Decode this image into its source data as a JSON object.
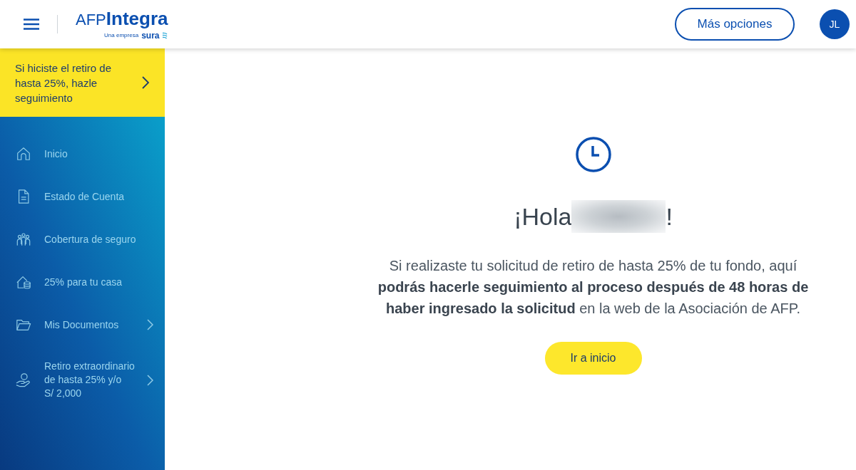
{
  "header": {
    "logo": {
      "wordmark": "AFP**Integra**",
      "tagline": "Una empresa",
      "brand": "sura"
    },
    "more_button": "Más opciones",
    "avatar_initials": "JL"
  },
  "sidebar": {
    "banner": {
      "text": "Si hiciste el retiro de hasta 25%, hazle seguimiento"
    },
    "items": [
      {
        "label": "Inicio",
        "has_submenu": false
      },
      {
        "label": "Estado de Cuenta",
        "has_submenu": false
      },
      {
        "label": "Cobertura de seguro",
        "has_submenu": false
      },
      {
        "label": "25% para tu casa",
        "has_submenu": false
      },
      {
        "label": "Mis Documentos",
        "has_submenu": true
      },
      {
        "label": "Retiro extraordinario de hasta 25% y/o S/ 2,000",
        "has_submenu": true
      }
    ]
  },
  "main": {
    "greeting": {
      "prefix": "¡Hola",
      "name_hidden": true,
      "suffix": "!"
    },
    "message": "Si realizaste tu solicitud de retiro de hasta 25% de tu fondo, aquí **podrás hacerle seguimiento al proceso después de 48 horas de haber ingresado la solicitud** en la web de la Asociación de AFP.",
    "button": "Ir a inicio"
  }
}
